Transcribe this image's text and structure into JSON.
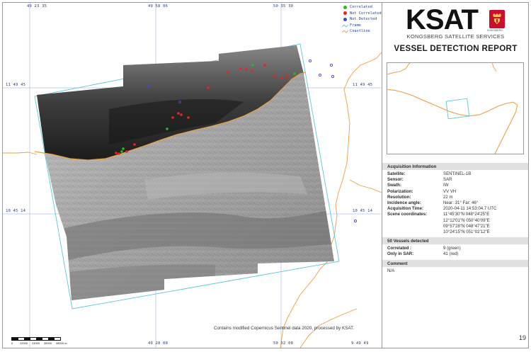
{
  "map": {
    "coords_top": [
      "49 23 35",
      "49 58 06",
      "50 35 30"
    ],
    "coords_bottom": [
      "49 28 08",
      "50 02 08",
      "9 49 49"
    ],
    "coords_left": [
      "11 49 45",
      "10 45 14"
    ],
    "coords_right": [
      "11 49 45",
      "10 45 14"
    ],
    "legend": [
      {
        "label": "Correlated",
        "color": "#22bb22",
        "kind": "dot",
        "icon": "green-dot-icon"
      },
      {
        "label": "Not Correlated",
        "color": "#ee2222",
        "kind": "dot",
        "icon": "red-dot-icon"
      },
      {
        "label": "Not Detected",
        "color": "#3a4ad8",
        "kind": "dot",
        "icon": "blue-dot-icon"
      },
      {
        "label": "Frame",
        "color": "#5cc7d8",
        "kind": "line",
        "icon": "frame-line-icon"
      },
      {
        "label": "Coastline",
        "color": "#e8a040",
        "kind": "line",
        "icon": "coastline-icon"
      }
    ],
    "credit": "Contains modified Copernicus Sentinel data 2020, processed by KSAT.",
    "scale_labels": [
      "0",
      "12000",
      "24000",
      "36000",
      "48000 m"
    ]
  },
  "header": {
    "logo_text": "KSAT",
    "logo_tagline": "KONGSBERG",
    "company_name": "KONGSBERG SATELLITE SERVICES",
    "report_title": "VESSEL DETECTION REPORT"
  },
  "acquisition": {
    "heading": "Acquisition Information",
    "rows": [
      {
        "key": "Satellite:",
        "value": "SENTINEL-1B"
      },
      {
        "key": "Sensor:",
        "value": "SAR"
      },
      {
        "key": "Swath:",
        "value": "IW"
      },
      {
        "key": "Polarization:",
        "value": "VV VH"
      },
      {
        "key": "Resolution:",
        "value": "22 m"
      },
      {
        "key": "Incidence angle:",
        "value": "Near: 31° Far: 46°"
      },
      {
        "key": "Acquisition Time:",
        "value": "2020-04-11 14:53:04.7 UTC"
      }
    ],
    "scene_key": "Scene coordinates:",
    "scene_lines": [
      "11°45'30\"N 048°24'25\"E",
      "12°12'01\"N 050°40'09\"E",
      "09°57'28\"N 048°47'21\"E",
      "10°24'15\"N 051°02'12\"E"
    ]
  },
  "vessels": {
    "heading": "50 Vessels detected",
    "rows": [
      {
        "key": "Correlated :",
        "value": "9 (green)"
      },
      {
        "key": "Only in SAR:",
        "value": "41 (red)"
      }
    ]
  },
  "comment": {
    "heading": "Comment",
    "value": "N/A"
  },
  "page_number": "19"
}
